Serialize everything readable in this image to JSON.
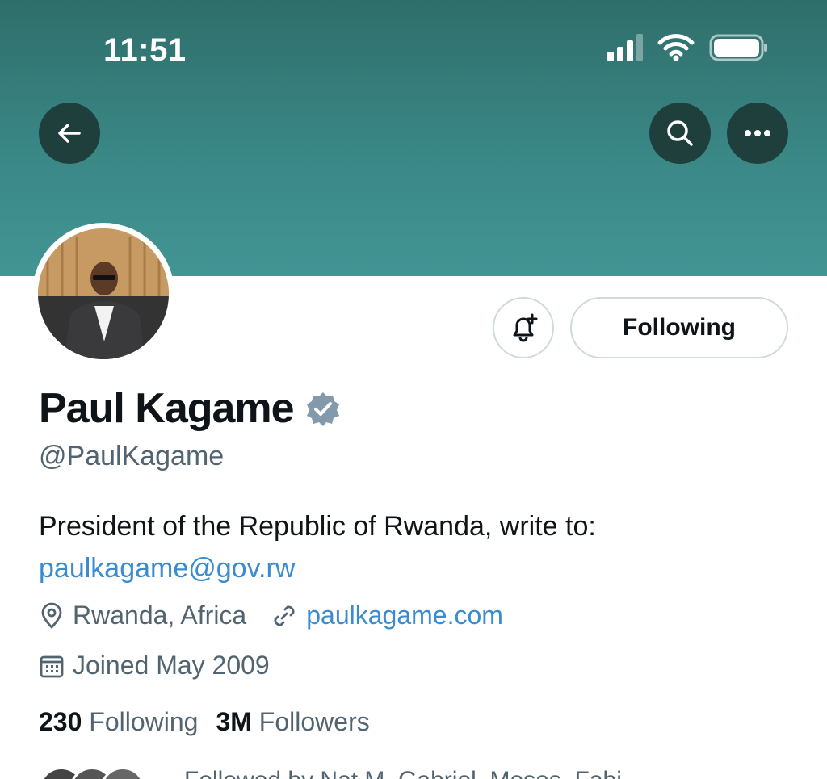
{
  "status_bar": {
    "time": "11:51"
  },
  "profile": {
    "name": "Paul Kagame",
    "handle": "@PaulKagame",
    "bio": "President of the Republic of Rwanda, write to:",
    "bio_link": "paulkagame@gov.rw",
    "location": "Rwanda, Africa",
    "website": "paulkagame.com",
    "joined": "Joined May 2009",
    "following_count": "230",
    "following_label": "Following",
    "followers_count": "3M",
    "followers_label": "Followers",
    "followed_by": "Followed by Nat M, Gabriel, Moses, Fabi..."
  },
  "actions": {
    "follow_state_label": "Following"
  },
  "icons": {
    "back": "arrow-left-icon",
    "search": "search-icon",
    "more": "more-horizontal-icon",
    "notify": "bell-plus-icon",
    "verified": "verified-badge-icon",
    "location": "location-pin-icon",
    "link": "link-icon",
    "calendar": "calendar-icon"
  },
  "colors": {
    "banner": "#3a8786",
    "link": "#3b8bd0",
    "secondary_text": "#536471",
    "verified_badge": "#829aab"
  }
}
